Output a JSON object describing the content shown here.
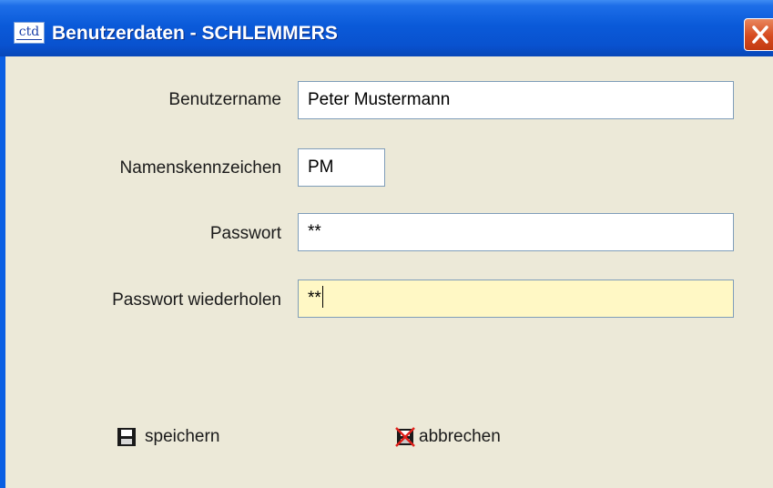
{
  "window": {
    "title": "Benutzerdaten - SCHLEMMERS",
    "app_icon_text": "ctd"
  },
  "form": {
    "fields": [
      {
        "label": "Benutzername",
        "value": "Peter Mustermann"
      },
      {
        "label": "Namenskennzeichen",
        "value": "PM"
      },
      {
        "label": "Passwort",
        "value": "**"
      },
      {
        "label": "Passwort wiederholen",
        "value": "**"
      }
    ]
  },
  "buttons": {
    "save_label": "speichern",
    "cancel_label": "abbrechen"
  },
  "colors": {
    "titlebar": "#0A5AD9",
    "window_bg": "#ECE9D8",
    "active_field_bg": "#FFF8C5",
    "close_button": "#D64A1F"
  },
  "icons": {
    "app": "ctd-app-icon",
    "close": "close-icon",
    "save": "floppy-disk-icon",
    "cancel": "cancel-icon"
  }
}
